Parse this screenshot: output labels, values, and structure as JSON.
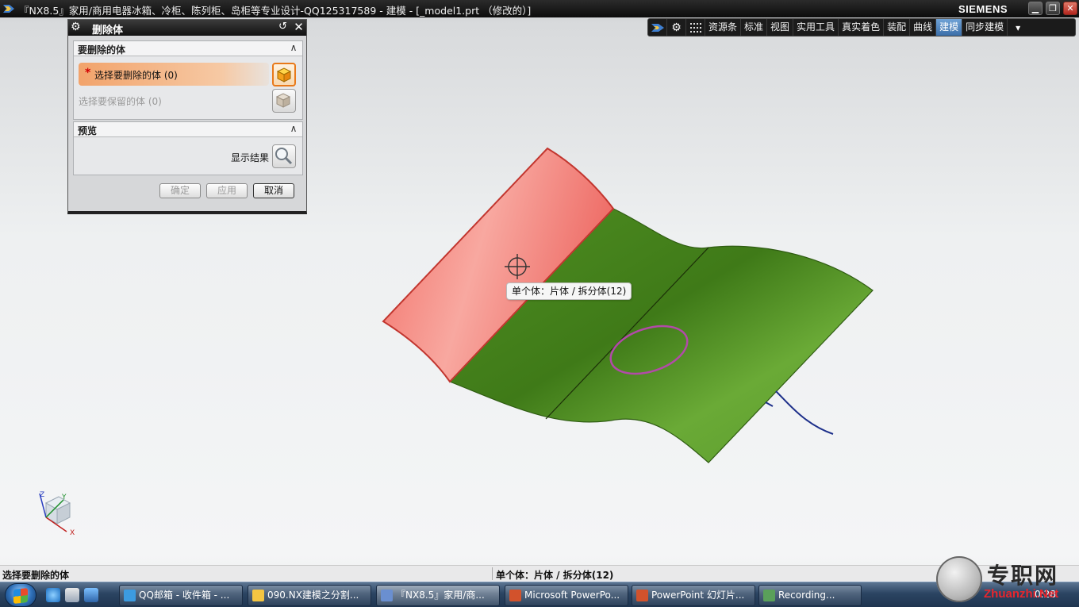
{
  "window": {
    "title": "『NX8.5』家用/商用电器冰箱、冷柜、陈列柜、岛柜等专业设计-QQ125317589 - 建模 - [_model1.prt （修改的）]",
    "brand": "SIEMENS",
    "min_glyph": "▁",
    "restore_glyph": "❐",
    "close_glyph": "✕"
  },
  "toolbar": {
    "tabs": [
      "资源条",
      "标准",
      "视图",
      "实用工具",
      "真实着色",
      "装配",
      "曲线",
      "建模",
      "同步建模"
    ],
    "active_tab": "建模",
    "more_glyph": "▾"
  },
  "dialog": {
    "title": "删除体",
    "group_bodies": {
      "label": "要删除的体",
      "select_delete_label": "选择要删除的体 (0)",
      "required_mark": "*",
      "select_keep_label": "选择要保留的体 (0)"
    },
    "group_preview": {
      "label": "预览",
      "show_result_label": "显示结果"
    },
    "buttons": {
      "ok": "确定",
      "apply": "应用",
      "cancel": "取消"
    },
    "caret_glyph": "∧",
    "reset_glyph": "↺",
    "close_glyph": "✕",
    "gear_glyph": "⚙"
  },
  "viewport": {
    "tooltip": "单个体：片体 / 拆分体(12)",
    "triad_labels": {
      "x": "X",
      "y": "Y",
      "z": "Z"
    },
    "colors": {
      "selected_body": "#f07a74",
      "sheet_body": "#5e9e2c",
      "edge_circle": "#b24aa8",
      "curve": "#1d2f8a"
    }
  },
  "statusbar": {
    "prompt": "选择要删除的体",
    "selection_info": "单个体：片体 / 拆分体(12)"
  },
  "taskbar": {
    "tasks": [
      {
        "label": "QQ邮箱 - 收件箱 - ...",
        "icon_color": "#3c9be0"
      },
      {
        "label": "090.NX建模之分割...",
        "icon_color": "#f4c542"
      },
      {
        "label": "『NX8.5』家用/商...",
        "icon_color": "#6a8fd0"
      },
      {
        "label": "Microsoft PowerPo...",
        "icon_color": "#d2522c"
      },
      {
        "label": "PowerPoint 幻灯片...",
        "icon_color": "#d2522c"
      },
      {
        "label": "Recording...",
        "icon_color": "#5aa05a"
      }
    ],
    "clock": "0:28"
  },
  "watermark": {
    "cn": "专职网",
    "url": "Zhuanzhi.Net"
  }
}
